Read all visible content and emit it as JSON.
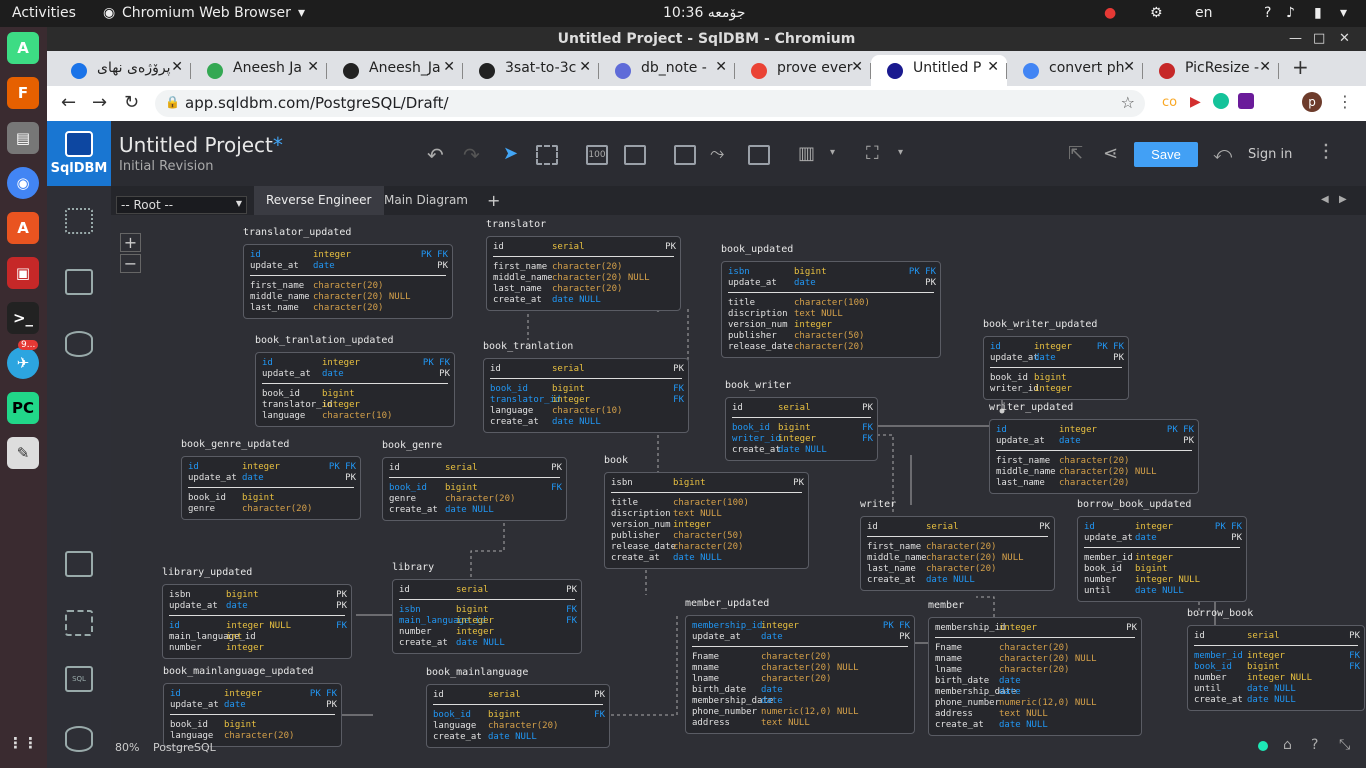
{
  "topbar": {
    "activities": "Activities",
    "browser": "Chromium Web Browser",
    "clock": "10:36 جۆمعە",
    "lang": "en",
    "question": "?"
  },
  "window": {
    "title": "Untitled Project - SqlDBM - Chromium"
  },
  "dock": {
    "badge": "9..."
  },
  "tabs": [
    {
      "label": "پرۆژەی نهای",
      "color": "#1a73e8"
    },
    {
      "label": "Aneesh Ja",
      "color": "#34a853"
    },
    {
      "label": "Aneesh_Ja",
      "color": "#222"
    },
    {
      "label": "3sat-to-3c",
      "color": "#222"
    },
    {
      "label": "db_note -",
      "color": "#5f6bd8"
    },
    {
      "label": "prove ever",
      "color": "#ea4335"
    },
    {
      "label": "Untitled P",
      "color": "#1a1a8f"
    },
    {
      "label": "convert ph",
      "color": "#4285f4"
    },
    {
      "label": "PicResize -",
      "color": "#c62828"
    }
  ],
  "address": {
    "url": "app.sqldbm.com/PostgreSQL/Draft/"
  },
  "app": {
    "brand": "SqlDBM",
    "title": "Untitled Project",
    "title_star": "*",
    "revision": "Initial Revision",
    "save": "Save",
    "signin": "Sign in",
    "root": "-- Root --",
    "tab_reverse": "Reverse Engineer",
    "tab_main": "Main Diagram",
    "tab_add": "+",
    "zoom_in": "+",
    "zoom_out": "−",
    "status_zoom": "80%",
    "status_db": "PostgreSQL",
    "toolbar_100": "100"
  },
  "tables": [
    {
      "name": "translator_updated",
      "rows": [
        [
          "id",
          "integer",
          "PK FK"
        ],
        [
          "update_at",
          "date",
          "PK"
        ],
        [
          "---"
        ],
        [
          "first_name",
          "character(20)",
          ""
        ],
        [
          "middle_name",
          "character(20) NULL",
          ""
        ],
        [
          "last_name",
          "character(20)",
          ""
        ]
      ]
    },
    {
      "name": "translator",
      "rows": [
        [
          "id",
          "serial",
          "PK"
        ],
        [
          "---"
        ],
        [
          "first_name",
          "character(20)",
          ""
        ],
        [
          "middle_name",
          "character(20) NULL",
          ""
        ],
        [
          "last_name",
          "character(20)",
          ""
        ],
        [
          "create_at",
          "date      NULL",
          ""
        ]
      ]
    },
    {
      "name": "book_updated",
      "rows": [
        [
          "isbn",
          "bigint",
          "PK FK"
        ],
        [
          "update_at",
          "date",
          "PK"
        ],
        [
          "---"
        ],
        [
          "title",
          "character(100)",
          ""
        ],
        [
          "discription",
          "text        NULL",
          ""
        ],
        [
          "version_num",
          "integer",
          ""
        ],
        [
          "publisher",
          "character(50)",
          ""
        ],
        [
          "release_date",
          "character(20)",
          ""
        ]
      ]
    },
    {
      "name": "book_writer_updated",
      "rows": [
        [
          "id",
          "integer",
          "PK FK"
        ],
        [
          "update_at",
          "date",
          "PK"
        ],
        [
          "---"
        ],
        [
          "book_id",
          "bigint",
          ""
        ],
        [
          "writer_id",
          "integer",
          ""
        ]
      ]
    },
    {
      "name": "book_tranlation_updated",
      "rows": [
        [
          "id",
          "integer",
          "PK FK"
        ],
        [
          "update_at",
          "date",
          "PK"
        ],
        [
          "---"
        ],
        [
          "book_id",
          "bigint",
          ""
        ],
        [
          "translator_id",
          "integer",
          ""
        ],
        [
          "language",
          "character(10)",
          ""
        ]
      ]
    },
    {
      "name": "book_tranlation",
      "rows": [
        [
          "id",
          "serial",
          "PK"
        ],
        [
          "---"
        ],
        [
          "book_id",
          "bigint",
          "FK"
        ],
        [
          "translator_id",
          "integer",
          "FK"
        ],
        [
          "language",
          "character(10)",
          ""
        ],
        [
          "create_at",
          "date      NULL",
          ""
        ]
      ]
    },
    {
      "name": "book_writer",
      "rows": [
        [
          "id",
          "serial",
          "PK"
        ],
        [
          "---"
        ],
        [
          "book_id",
          "bigint",
          "FK"
        ],
        [
          "writer_id",
          "integer",
          "FK"
        ],
        [
          "create_at",
          "date   NULL",
          ""
        ]
      ]
    },
    {
      "name": "writer_updated",
      "rows": [
        [
          "id",
          "integer",
          "PK FK"
        ],
        [
          "update_at",
          "date",
          "PK"
        ],
        [
          "---"
        ],
        [
          "first_name",
          "character(20)",
          ""
        ],
        [
          "middle_name",
          "character(20) NULL",
          ""
        ],
        [
          "last_name",
          "character(20)",
          ""
        ]
      ]
    },
    {
      "name": "book_genre_updated",
      "rows": [
        [
          "id",
          "integer",
          "PK FK"
        ],
        [
          "update_at",
          "date",
          "PK"
        ],
        [
          "---"
        ],
        [
          "book_id",
          "bigint",
          ""
        ],
        [
          "genre",
          "character(20)",
          ""
        ]
      ]
    },
    {
      "name": "book_genre",
      "rows": [
        [
          "id",
          "serial",
          "PK"
        ],
        [
          "---"
        ],
        [
          "book_id",
          "bigint",
          "FK"
        ],
        [
          "genre",
          "character(20)",
          ""
        ],
        [
          "create_at",
          "date      NULL",
          ""
        ]
      ]
    },
    {
      "name": "book",
      "rows": [
        [
          "isbn",
          "bigint",
          "PK"
        ],
        [
          "---"
        ],
        [
          "title",
          "character(100)",
          ""
        ],
        [
          "discription",
          "text        NULL",
          ""
        ],
        [
          "version_num",
          "integer",
          ""
        ],
        [
          "publisher",
          "character(50)",
          ""
        ],
        [
          "release_date",
          "character(20)",
          ""
        ],
        [
          "create_at",
          "date        NULL",
          ""
        ]
      ]
    },
    {
      "name": "writer",
      "rows": [
        [
          "id",
          "serial",
          "PK"
        ],
        [
          "---"
        ],
        [
          "first_name",
          "character(20)",
          ""
        ],
        [
          "middle_name",
          "character(20) NULL",
          ""
        ],
        [
          "last_name",
          "character(20)",
          ""
        ],
        [
          "create_at",
          "date          NULL",
          ""
        ]
      ]
    },
    {
      "name": "borrow_book_updated",
      "rows": [
        [
          "id",
          "integer",
          "PK FK"
        ],
        [
          "update_at",
          "date",
          "PK"
        ],
        [
          "---"
        ],
        [
          "member_id",
          "integer",
          ""
        ],
        [
          "book_id",
          "bigint",
          ""
        ],
        [
          "number",
          "integer NULL",
          ""
        ],
        [
          "until",
          "date    NULL",
          ""
        ]
      ]
    },
    {
      "name": "library_updated",
      "rows": [
        [
          "isbn",
          "bigint",
          "PK"
        ],
        [
          "update_at",
          "date",
          "PK"
        ],
        [
          "---"
        ],
        [
          "id",
          "integer NULL",
          "FK"
        ],
        [
          "main_language_id",
          "int",
          ""
        ],
        [
          "number",
          "integer",
          ""
        ]
      ]
    },
    {
      "name": "library",
      "rows": [
        [
          "id",
          "serial",
          "PK"
        ],
        [
          "---"
        ],
        [
          "isbn",
          "bigint",
          "FK"
        ],
        [
          "main_language_id",
          "integer",
          "FK"
        ],
        [
          "number",
          "integer",
          ""
        ],
        [
          "create_at",
          "date      NULL",
          ""
        ]
      ]
    },
    {
      "name": "member_updated",
      "rows": [
        [
          "membership_id",
          "integer",
          "PK FK"
        ],
        [
          "update_at",
          "date",
          "PK"
        ],
        [
          "---"
        ],
        [
          "Fname",
          "character(20)",
          ""
        ],
        [
          "mname",
          "character(20) NULL",
          ""
        ],
        [
          "lname",
          "character(20)",
          ""
        ],
        [
          "birth_date",
          "date",
          ""
        ],
        [
          "membership_date",
          "date",
          ""
        ],
        [
          "phone_number",
          "numeric(12,0)  NULL",
          ""
        ],
        [
          "address",
          "text           NULL",
          ""
        ]
      ]
    },
    {
      "name": "member",
      "rows": [
        [
          "membership_id",
          "integer",
          "PK"
        ],
        [
          "---"
        ],
        [
          "Fname",
          "character(20)",
          ""
        ],
        [
          "mname",
          "character(20) NULL",
          ""
        ],
        [
          "lname",
          "character(20)",
          ""
        ],
        [
          "birth_date",
          "date",
          ""
        ],
        [
          "membership_date",
          "date",
          ""
        ],
        [
          "phone_number",
          "numeric(12,0)  NULL",
          ""
        ],
        [
          "address",
          "text           NULL",
          ""
        ],
        [
          "create_at",
          "date           NULL",
          ""
        ]
      ]
    },
    {
      "name": "borrow_book",
      "rows": [
        [
          "id",
          "serial",
          "PK"
        ],
        [
          "---"
        ],
        [
          "member_id",
          "integer",
          "FK"
        ],
        [
          "book_id",
          "bigint",
          "FK"
        ],
        [
          "number",
          "integer  NULL",
          ""
        ],
        [
          "until",
          "date     NULL",
          ""
        ],
        [
          "create_at",
          "date     NULL",
          ""
        ]
      ]
    },
    {
      "name": "book_mainlanguage_updated",
      "rows": [
        [
          "id",
          "integer",
          "PK FK"
        ],
        [
          "update_at",
          "date",
          "PK"
        ],
        [
          "---"
        ],
        [
          "book_id",
          "bigint",
          ""
        ],
        [
          "language",
          "character(20)",
          ""
        ]
      ]
    },
    {
      "name": "book_mainlanguage",
      "rows": [
        [
          "id",
          "serial",
          "PK"
        ],
        [
          "---"
        ],
        [
          "book_id",
          "bigint",
          "FK"
        ],
        [
          "language",
          "character(20)",
          ""
        ],
        [
          "create_at",
          "date      NULL",
          ""
        ]
      ]
    }
  ]
}
